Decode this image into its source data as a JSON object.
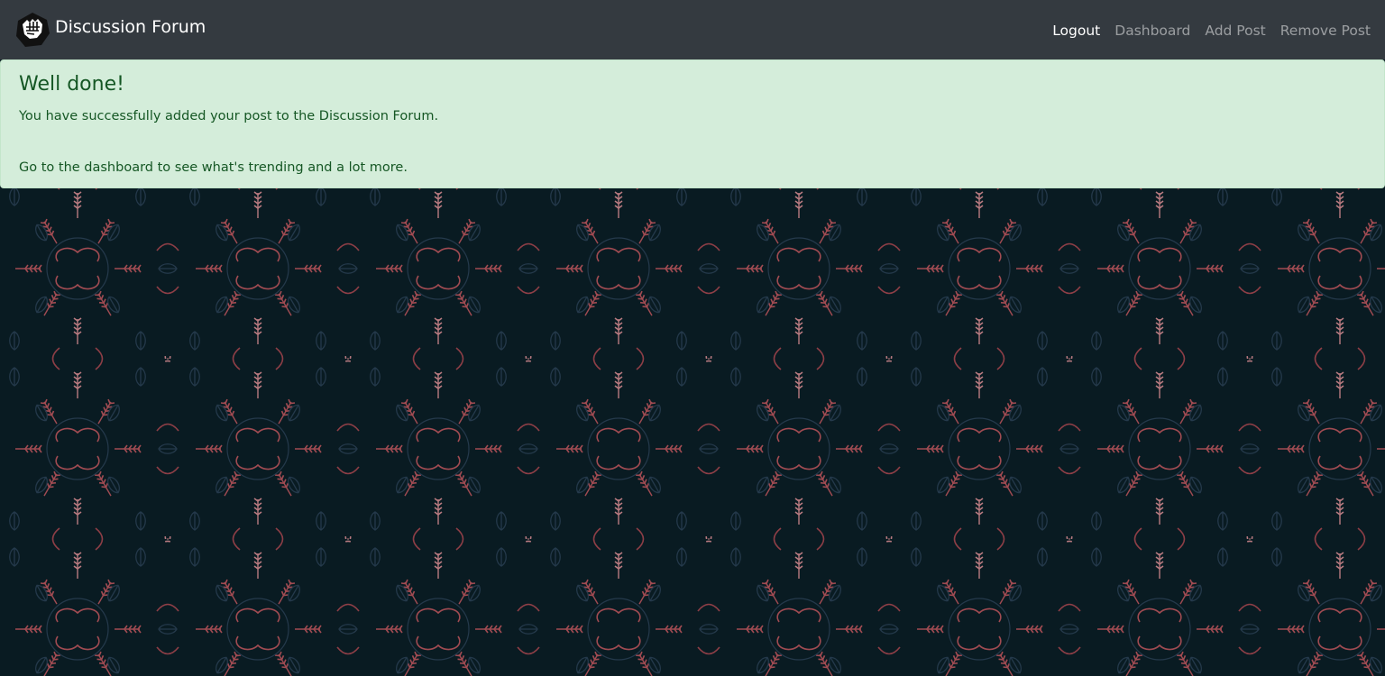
{
  "navbar": {
    "brand_title": "Discussion Forum",
    "links": [
      {
        "label": "Logout",
        "active": true
      },
      {
        "label": "Dashboard",
        "active": false
      },
      {
        "label": "Add Post",
        "active": false
      },
      {
        "label": "Remove Post",
        "active": false
      }
    ]
  },
  "alert": {
    "heading": "Well done!",
    "message": "You have successfully added your post to the Discussion Forum.",
    "followup": "Go to the dashboard to see what's trending and a lot more."
  },
  "colors": {
    "navbar_bg": "#343a40",
    "alert_bg": "#d4edda",
    "alert_text": "#155724",
    "page_bg": "#091b22",
    "pattern_red": "#a84a52",
    "pattern_blue": "#243a4c"
  },
  "icons": {
    "brand_logo": "fist-logo-icon"
  }
}
